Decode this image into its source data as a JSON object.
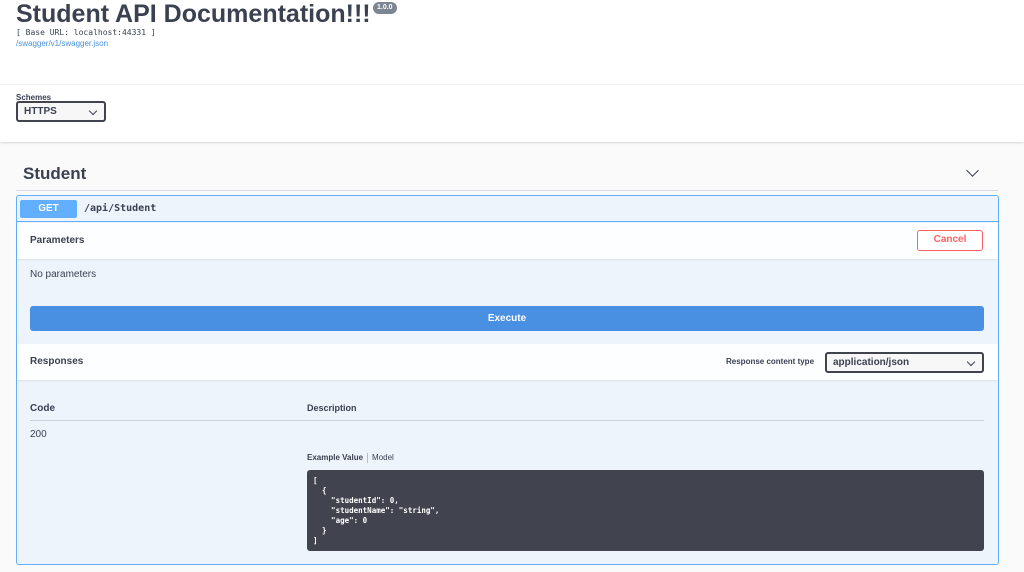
{
  "info": {
    "title": "Student API Documentation!!!",
    "version": "1.0.0",
    "base_url": "[ Base URL: localhost:44331 ]",
    "spec_link": "/swagger/v1/swagger.json"
  },
  "schemes": {
    "label": "Schemes",
    "selected": "HTTPS"
  },
  "tag": {
    "name": "Student"
  },
  "operation": {
    "method": "GET",
    "path": "/api/Student",
    "parameters_title": "Parameters",
    "cancel_label": "Cancel",
    "no_parameters": "No parameters",
    "execute_label": "Execute",
    "responses_title": "Responses",
    "response_content_type_label": "Response content type",
    "response_content_type": "application/json",
    "columns": {
      "code": "Code",
      "description": "Description"
    },
    "response": {
      "code": "200",
      "example_tab": "Example Value",
      "model_tab": "Model",
      "example_value": "[\n  {\n    \"studentId\": 0,\n    \"studentName\": \"string\",\n    \"age\": 0\n  }\n]"
    }
  },
  "colors": {
    "get": "#61affe",
    "execute": "#4990e2",
    "cancel": "#ff6060",
    "code_bg": "#41444e"
  }
}
